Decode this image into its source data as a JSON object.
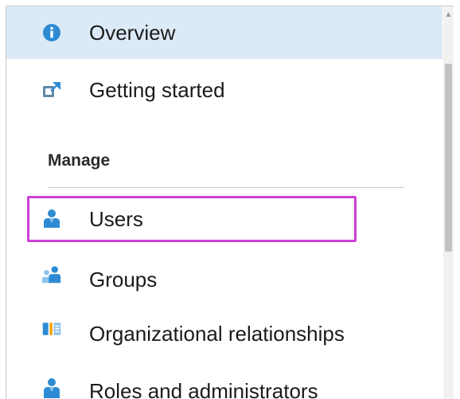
{
  "nav": {
    "items": [
      {
        "label": "Overview",
        "icon": "info-icon"
      },
      {
        "label": "Getting started",
        "icon": "quickstart-icon"
      }
    ],
    "section": {
      "title": "Manage",
      "items": [
        {
          "label": "Users",
          "icon": "user-icon"
        },
        {
          "label": "Groups",
          "icon": "groups-icon"
        },
        {
          "label": "Organizational relationships",
          "icon": "org-relationships-icon"
        },
        {
          "label": "Roles and administrators",
          "icon": "roles-icon"
        }
      ]
    }
  },
  "colors": {
    "selected_background": "#dceaf7",
    "highlight_border": "#cc3fd6",
    "icon_blue": "#2e8bd3"
  }
}
